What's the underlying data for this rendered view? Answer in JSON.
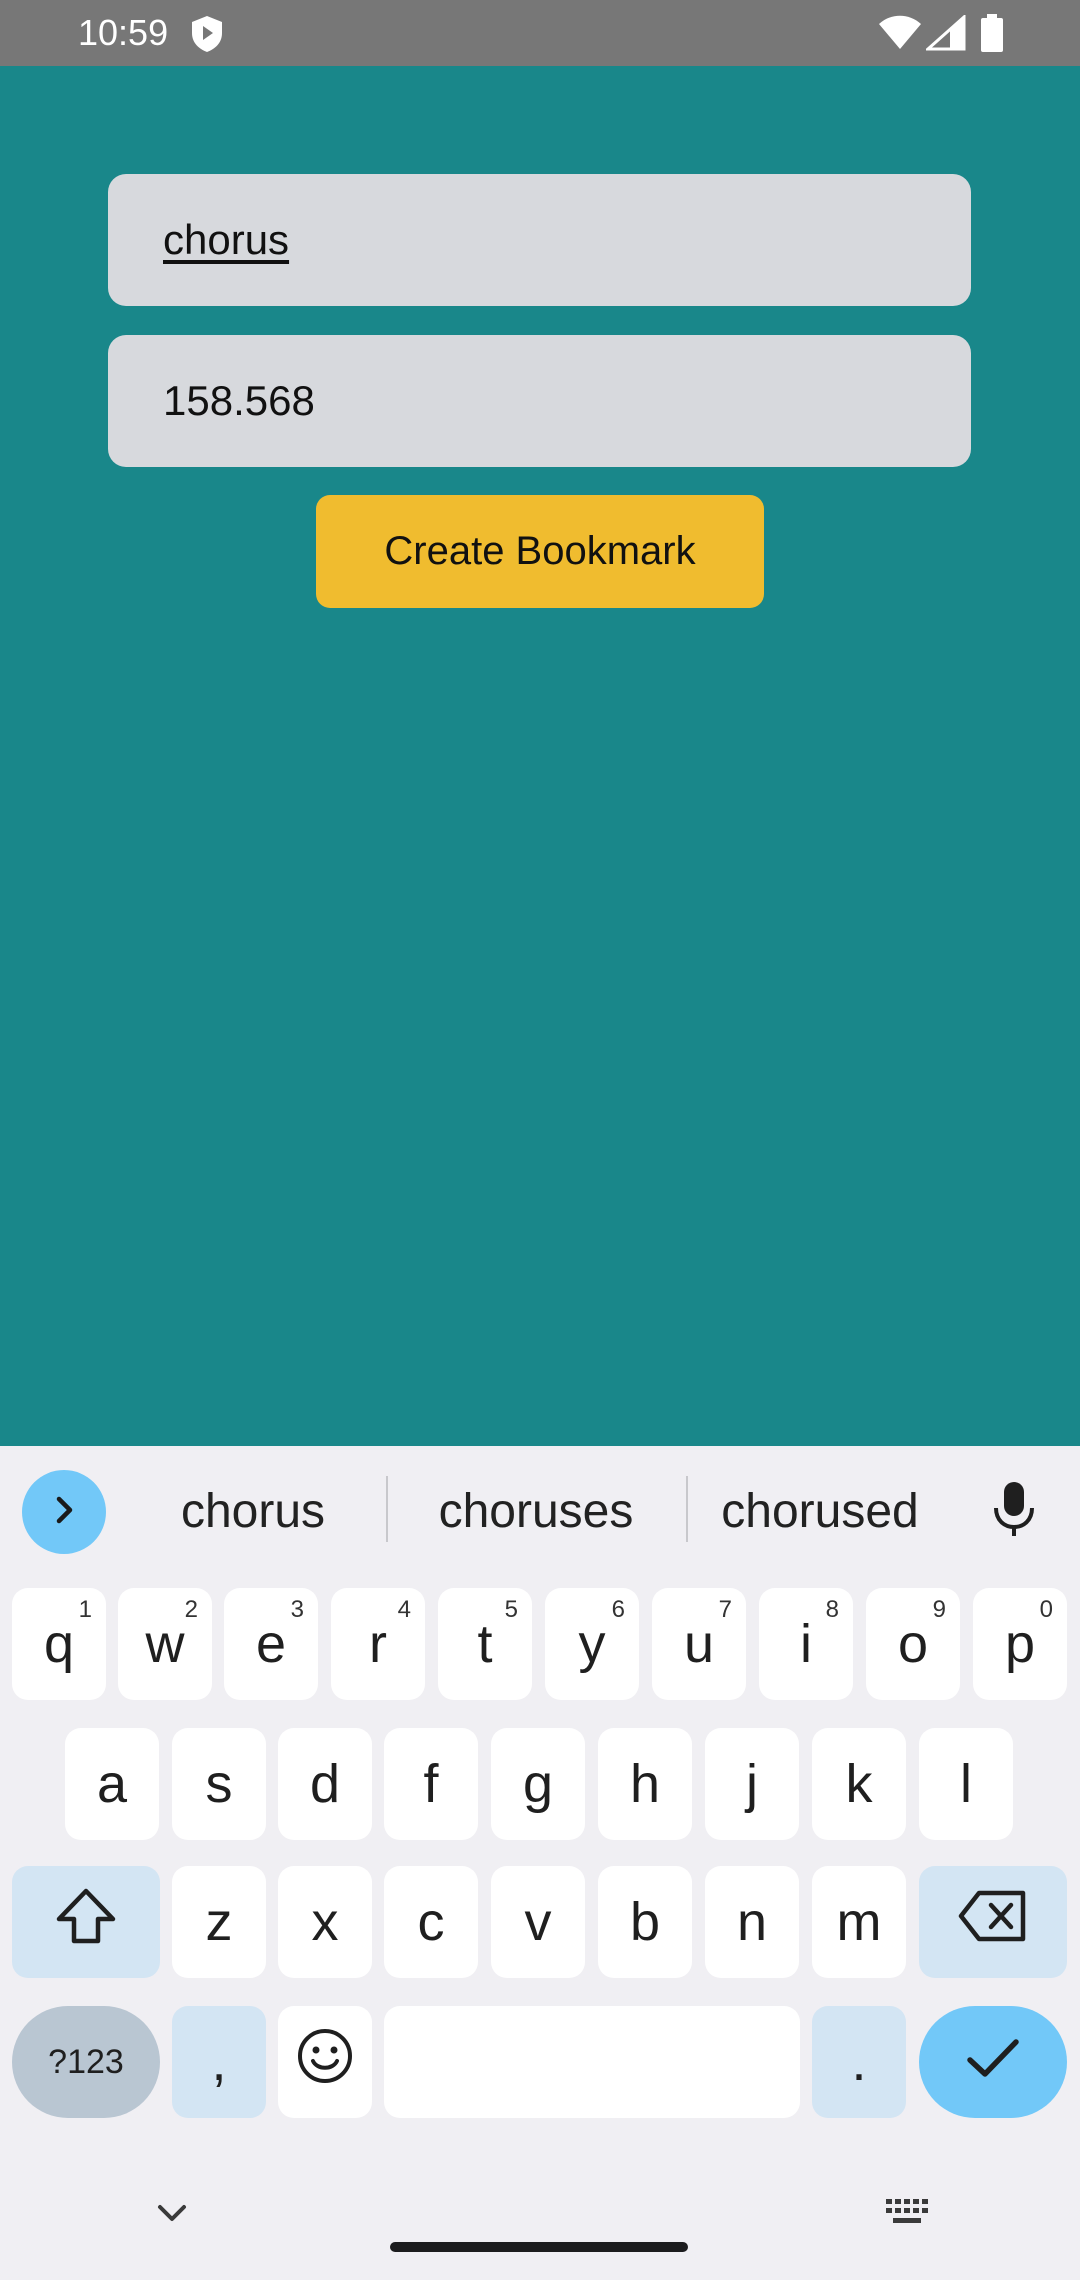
{
  "status_bar": {
    "time": "10:59"
  },
  "form": {
    "label_value": "chorus",
    "timestamp_value": "158.568",
    "create_button_label": "Create Bookmark"
  },
  "keyboard": {
    "suggestions": [
      "chorus",
      "choruses",
      "chorused"
    ],
    "row1": [
      {
        "key": "q",
        "hint": "1"
      },
      {
        "key": "w",
        "hint": "2"
      },
      {
        "key": "e",
        "hint": "3"
      },
      {
        "key": "r",
        "hint": "4"
      },
      {
        "key": "t",
        "hint": "5"
      },
      {
        "key": "y",
        "hint": "6"
      },
      {
        "key": "u",
        "hint": "7"
      },
      {
        "key": "i",
        "hint": "8"
      },
      {
        "key": "o",
        "hint": "9"
      },
      {
        "key": "p",
        "hint": "0"
      }
    ],
    "row2": [
      "a",
      "s",
      "d",
      "f",
      "g",
      "h",
      "j",
      "k",
      "l"
    ],
    "row3": [
      "z",
      "x",
      "c",
      "v",
      "b",
      "n",
      "m"
    ],
    "symbols_label": "?123",
    "comma_label": ",",
    "period_label": "."
  },
  "colors": {
    "app_background": "#19878a",
    "field_background": "#d7d9dd",
    "button_background": "#f0bc2f",
    "status_bar": "#777777",
    "keyboard_accent": "#72c8f8"
  },
  "icons": {
    "status": [
      "shield-icon",
      "wifi-icon",
      "signal-icon",
      "battery-icon"
    ],
    "keyboard": [
      "chevron-right-icon",
      "mic-icon",
      "shift-icon",
      "backspace-icon",
      "emoji-icon",
      "check-icon",
      "chevron-down-icon",
      "keyboard-icon"
    ]
  }
}
